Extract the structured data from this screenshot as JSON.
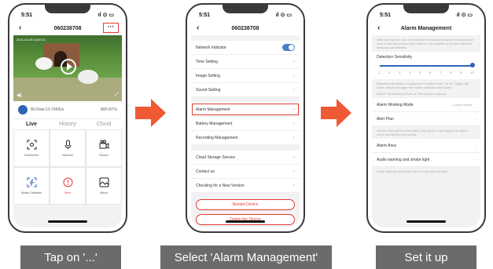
{
  "status_time": "5:51",
  "screen1": {
    "device_id": "060238708",
    "more_label": "···",
    "video_stamp": "2021-04-08 16:59:21",
    "bit_rate": "Bit Rate:10.74KB/s",
    "wifi": "WiFi:87%",
    "tabs": [
      {
        "label": "Live",
        "active": true
      },
      {
        "label": "History",
        "active": false
      },
      {
        "label": "Cloud",
        "active": false
      }
    ],
    "grid": [
      {
        "label": "Screenshot",
        "icon": "camera-frame-icon",
        "red": false
      },
      {
        "label": "Intercom",
        "icon": "microphone-icon",
        "red": false
      },
      {
        "label": "Record",
        "icon": "video-camera-icon",
        "red": false
      },
      {
        "label": "Motion Detection",
        "icon": "motion-detection-icon",
        "red": false
      },
      {
        "label": "Siren",
        "icon": "siren-icon",
        "red": true
      },
      {
        "label": "Album",
        "icon": "album-icon",
        "red": false
      }
    ],
    "caption": "Tap on '...'"
  },
  "screen2": {
    "title": "060238708",
    "group1": [
      "Network Indicator",
      "Time Setting",
      "Image Setting",
      "Sound Setting"
    ],
    "group2": [
      "Alarm Management",
      "Battery Management",
      "Recording Management"
    ],
    "group3": [
      "Cloud Storage Service",
      "Contact us",
      "Checking for a New Version"
    ],
    "restart_label": "Restart Device",
    "delete_label": "Delete the Device",
    "caption": "Select 'Alarm Management'"
  },
  "screen3": {
    "title": "Alarm Management",
    "intro": "After turning it on, you can monitor the human behavior who stands in front of the device and send alarms. It is possible to choose different detection sensitivities",
    "sens_title": "Detection Sensitivity",
    "sens_value": 10,
    "ticks": [
      "1",
      "2",
      "3",
      "4",
      "5",
      "6",
      "7",
      "8",
      "9",
      "10"
    ],
    "sens_note": "Detection sensitivity is supported to select from 1 to 10. Higher the value, easier to trigger the motion detection and alarm.",
    "mode_note": "Select The Working Mode of The Current Camera",
    "working_mode_label": "Alarm Working Mode",
    "working_mode_value": "Custom Mode",
    "alert_plan_label": "Alert Plan",
    "plan_note": "Set the time period of the alarm, the device only triggers an alarm event during this time period.",
    "alarm_area_label": "Alarm Area",
    "audio_label": "Audio warning and strobe light",
    "audio_note": "Audio warning and strobe light is only valid at night",
    "caption": "Set it up"
  },
  "colors": {
    "accent_red": "#e53935",
    "arrow": "#ef5a35",
    "caption_bg": "#6b6b6b",
    "blue": "#2f64b5"
  }
}
